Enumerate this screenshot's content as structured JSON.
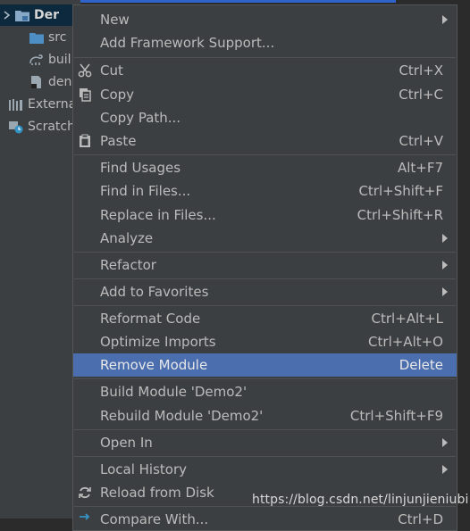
{
  "tree": {
    "root_label": "Der",
    "items": [
      "src",
      "buil",
      "den",
      "Externa",
      "Scratch"
    ]
  },
  "menu": {
    "items": [
      {
        "label": "New",
        "shortcut": "",
        "submenu": true
      },
      {
        "label": "Add Framework Support...",
        "shortcut": "",
        "submenu": false
      },
      {
        "label": "Cut",
        "shortcut": "Ctrl+X",
        "submenu": false,
        "icon": "scissors-icon"
      },
      {
        "label": "Copy",
        "shortcut": "Ctrl+C",
        "submenu": false,
        "icon": "copy-icon"
      },
      {
        "label": "Copy Path...",
        "shortcut": "",
        "submenu": false
      },
      {
        "label": "Paste",
        "shortcut": "Ctrl+V",
        "submenu": false,
        "icon": "clipboard-icon"
      },
      {
        "label": "Find Usages",
        "shortcut": "Alt+F7",
        "submenu": false
      },
      {
        "label": "Find in Files...",
        "shortcut": "Ctrl+Shift+F",
        "submenu": false
      },
      {
        "label": "Replace in Files...",
        "shortcut": "Ctrl+Shift+R",
        "submenu": false
      },
      {
        "label": "Analyze",
        "shortcut": "",
        "submenu": true
      },
      {
        "label": "Refactor",
        "shortcut": "",
        "submenu": true
      },
      {
        "label": "Add to Favorites",
        "shortcut": "",
        "submenu": true
      },
      {
        "label": "Reformat Code",
        "shortcut": "Ctrl+Alt+L",
        "submenu": false
      },
      {
        "label": "Optimize Imports",
        "shortcut": "Ctrl+Alt+O",
        "submenu": false
      },
      {
        "label": "Remove Module",
        "shortcut": "Delete",
        "submenu": false,
        "highlighted": true
      },
      {
        "label": "Build Module 'Demo2'",
        "shortcut": "",
        "submenu": false
      },
      {
        "label": "Rebuild Module 'Demo2'",
        "shortcut": "Ctrl+Shift+F9",
        "submenu": false
      },
      {
        "label": "Open In",
        "shortcut": "",
        "submenu": true
      },
      {
        "label": "Local History",
        "shortcut": "",
        "submenu": true
      },
      {
        "label": "Reload from Disk",
        "shortcut": "",
        "submenu": false,
        "icon": "reload-icon"
      },
      {
        "label": "Compare With...",
        "shortcut": "Ctrl+D",
        "submenu": false,
        "icon": "compare-icon"
      }
    ]
  },
  "watermark": "https://blog.csdn.net/linjunjieniubi",
  "colors": {
    "menu_bg": "#3c3f41",
    "highlight": "#4b6eaf",
    "text": "#bbbbbb",
    "tree_selection": "#0d293e"
  }
}
